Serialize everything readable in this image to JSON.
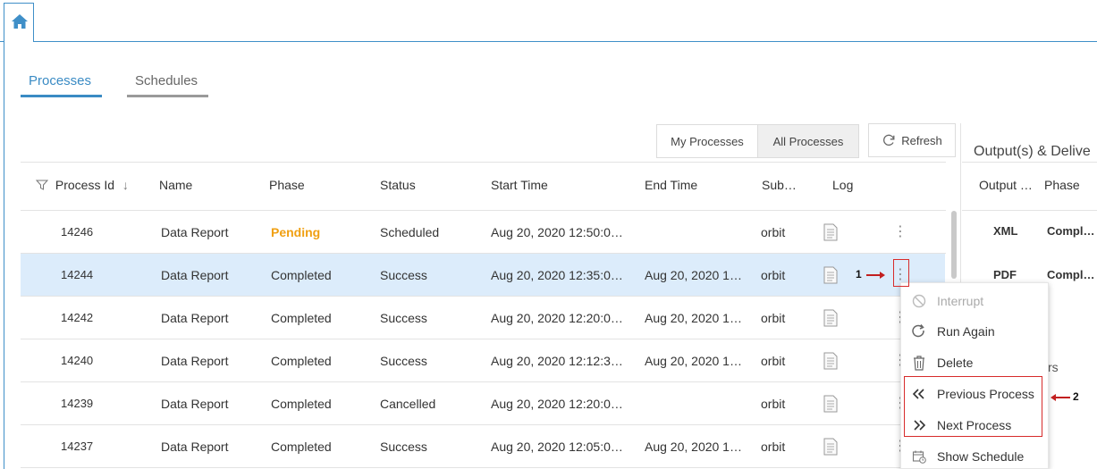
{
  "home_icon": "home-icon",
  "tabs": [
    {
      "label": "Processes",
      "active": true
    },
    {
      "label": "Schedules",
      "active": false
    }
  ],
  "toolbar": {
    "my_processes": "My Processes",
    "all_processes": "All Processes",
    "refresh": "Refresh"
  },
  "table": {
    "headers": {
      "process_id": "Process Id",
      "name": "Name",
      "phase": "Phase",
      "status": "Status",
      "start_time": "Start Time",
      "end_time": "End Time",
      "submitter": "Sub…",
      "log": "Log"
    },
    "rows": [
      {
        "id": "14246",
        "name": "Data Report",
        "phase": "Pending",
        "status": "Scheduled",
        "start": "Aug 20, 2020 12:50:0…",
        "end": "",
        "sub": "orbit"
      },
      {
        "id": "14244",
        "name": "Data Report",
        "phase": "Completed",
        "status": "Success",
        "start": "Aug 20, 2020 12:35:0…",
        "end": "Aug 20, 2020 1…",
        "sub": "orbit"
      },
      {
        "id": "14242",
        "name": "Data Report",
        "phase": "Completed",
        "status": "Success",
        "start": "Aug 20, 2020 12:20:0…",
        "end": "Aug 20, 2020 1…",
        "sub": "orbit"
      },
      {
        "id": "14240",
        "name": "Data Report",
        "phase": "Completed",
        "status": "Success",
        "start": "Aug 20, 2020 12:12:3…",
        "end": "Aug 20, 2020 1…",
        "sub": "orbit"
      },
      {
        "id": "14239",
        "name": "Data Report",
        "phase": "Completed",
        "status": "Cancelled",
        "start": "Aug 20, 2020 12:20:0…",
        "end": "",
        "sub": "orbit"
      },
      {
        "id": "14237",
        "name": "Data Report",
        "phase": "Completed",
        "status": "Success",
        "start": "Aug 20, 2020 12:05:0…",
        "end": "Aug 20, 2020 1…",
        "sub": "orbit"
      }
    ]
  },
  "output_panel": {
    "title": "Output(s) & Delive",
    "headers": {
      "output": "Output …",
      "phase": "Phase"
    },
    "rows": [
      {
        "output": "XML",
        "phase": "Compl…"
      },
      {
        "output": "PDF",
        "phase": "Compl…"
      }
    ],
    "partial_text": "rs"
  },
  "context_menu": {
    "items": [
      {
        "label": "Interrupt",
        "icon": "ban-icon",
        "disabled": true
      },
      {
        "label": "Run Again",
        "icon": "redo-icon",
        "disabled": false
      },
      {
        "label": "Delete",
        "icon": "trash-icon",
        "disabled": false
      },
      {
        "label": "Previous Process",
        "icon": "double-chevron-left-icon",
        "disabled": false
      },
      {
        "label": "Next Process",
        "icon": "double-chevron-right-icon",
        "disabled": false
      },
      {
        "label": "Show Schedule",
        "icon": "calendar-icon",
        "disabled": false
      }
    ]
  },
  "annotations": {
    "one": "1",
    "two": "2"
  },
  "colors": {
    "accent": "#3a8bc4",
    "pending": "#f0a013",
    "selected_row": "#dcecfb",
    "annotation": "#d72b2b"
  }
}
